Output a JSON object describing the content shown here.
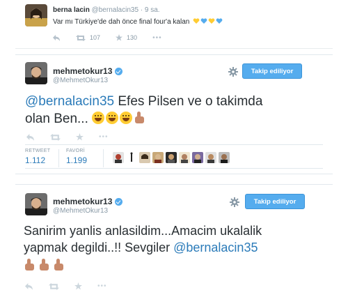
{
  "tweet_top": {
    "name": "berna lacin",
    "handle": "@bernalacin35",
    "time": "· 9 sa.",
    "text": "Var mı Türkiye'de dah önce final four'a kalan",
    "retweet_count": "107",
    "favorite_count": "130"
  },
  "tweet_main": {
    "name": "mehmetokur13",
    "handle": "@MehmetOkur13",
    "follow_label": "Takip ediliyor",
    "mention": "@bernalacin35",
    "text_line1_rest": " Efes Pilsen ve o takimda",
    "text_line2": "olan Ben...",
    "stats": {
      "retweet_label": "RETWEET",
      "retweet_value": "1.112",
      "favorite_label": "FAVORİ",
      "favorite_value": "1.199"
    }
  },
  "tweet_reply": {
    "name": "mehmetokur13",
    "handle": "@MehmetOkur13",
    "follow_label": "Takip ediliyor",
    "text_line1": "Sanirim yanlis anlasildim...Amacim ukalalik",
    "text_line2_before": "yapmak degildi..!! Sevgiler ",
    "mention": "@bernalacin35"
  },
  "colors": {
    "accent": "#55acee",
    "link": "#2b7bb9",
    "heart_yellow": "#ffcc33",
    "heart_blue": "#55acee"
  },
  "icons": [
    "reply-icon",
    "retweet-icon",
    "favorite-icon",
    "more-icon",
    "gear-icon",
    "verified-badge-icon"
  ]
}
